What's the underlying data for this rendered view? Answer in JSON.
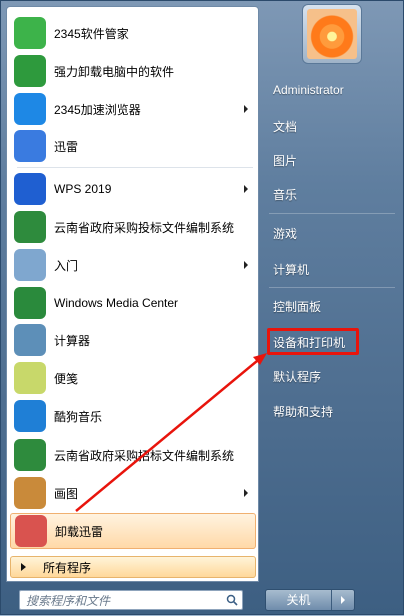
{
  "programs": [
    {
      "label": "2345软件管家",
      "icon": "software-manager-icon",
      "arrow": false,
      "color": "#3db34a"
    },
    {
      "label": "强力卸载电脑中的软件",
      "icon": "recycle-bin-icon",
      "arrow": false,
      "color": "#2e9a3d"
    },
    {
      "label": "2345加速浏览器",
      "icon": "browser-e-icon",
      "arrow": true,
      "color": "#1e88e5"
    },
    {
      "label": "迅雷",
      "icon": "xunlei-bird-icon",
      "arrow": false,
      "color": "#3a7be0"
    },
    {
      "label": "WPS 2019",
      "icon": "wps-icon",
      "arrow": true,
      "color": "#1f5fd1"
    },
    {
      "label": "云南省政府采购投标文件编制系统",
      "icon": "bid-tool-icon",
      "arrow": false,
      "color": "#2e8b3d"
    },
    {
      "label": "入门",
      "icon": "getting-started-icon",
      "arrow": true,
      "color": "#7fa7cf"
    },
    {
      "label": "Windows Media Center",
      "icon": "windows-media-center-icon",
      "arrow": false,
      "color": "#2a8a3c"
    },
    {
      "label": "计算器",
      "icon": "calculator-icon",
      "arrow": false,
      "color": "#5d8fb8"
    },
    {
      "label": "便笺",
      "icon": "sticky-notes-icon",
      "arrow": false,
      "color": "#c8d86a"
    },
    {
      "label": "酷狗音乐",
      "icon": "kugou-icon",
      "arrow": false,
      "color": "#1f7fd6"
    },
    {
      "label": "云南省政府采购招标文件编制系统",
      "icon": "tender-tool-icon",
      "arrow": false,
      "color": "#2e8b3d"
    },
    {
      "label": "画图",
      "icon": "paint-icon",
      "arrow": true,
      "color": "#c98a3a"
    },
    {
      "label": "卸载迅雷",
      "icon": "uninstall-xunlei-icon",
      "arrow": false,
      "color": "#d9534f"
    }
  ],
  "all_programs": "所有程序",
  "search_placeholder": "搜索程序和文件",
  "right": {
    "user": "Administrator",
    "items": [
      "文档",
      "图片",
      "音乐",
      "游戏",
      "计算机",
      "控制面板",
      "设备和打印机",
      "默认程序",
      "帮助和支持"
    ]
  },
  "shutdown": "关机",
  "colors": {
    "highlight_border": "#e8140c",
    "arrow": "#e8140c"
  }
}
